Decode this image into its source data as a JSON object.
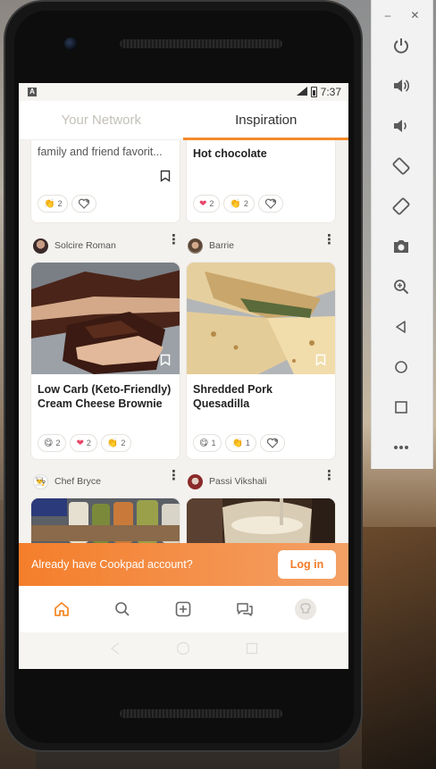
{
  "status_bar": {
    "time": "7:37",
    "notif_icon": "A"
  },
  "tabs": [
    {
      "label": "Your Network",
      "active": false
    },
    {
      "label": "Inspiration",
      "active": true
    }
  ],
  "cards_top": [
    {
      "subtitle": "family and friend favorit...",
      "reactions": [
        {
          "emoji": "clap",
          "count": "2"
        }
      ]
    },
    {
      "title": "Hot chocolate",
      "reactions": [
        {
          "emoji": "heart",
          "count": "2"
        },
        {
          "emoji": "clap",
          "count": "2"
        }
      ]
    }
  ],
  "cards_mid": [
    {
      "author": "Solcire Roman",
      "title": "Low Carb (Keto-Friendly) Cream Cheese Brownie",
      "reactions": [
        {
          "emoji": "yum",
          "count": "2"
        },
        {
          "emoji": "heart",
          "count": "2"
        },
        {
          "emoji": "clap",
          "count": "2"
        }
      ]
    },
    {
      "author": "Barrie",
      "title": "Shredded Pork Quesadilla",
      "reactions": [
        {
          "emoji": "yum",
          "count": "1"
        },
        {
          "emoji": "clap",
          "count": "1"
        }
      ]
    }
  ],
  "cards_bottom": [
    {
      "author": "Chef Bryce"
    },
    {
      "author": "Passi Vikshali"
    }
  ],
  "banner": {
    "text": "Already have Cookpad account?",
    "button": "Log in"
  },
  "colors": {
    "accent": "#f58a2a",
    "heart": "#e8476a"
  }
}
